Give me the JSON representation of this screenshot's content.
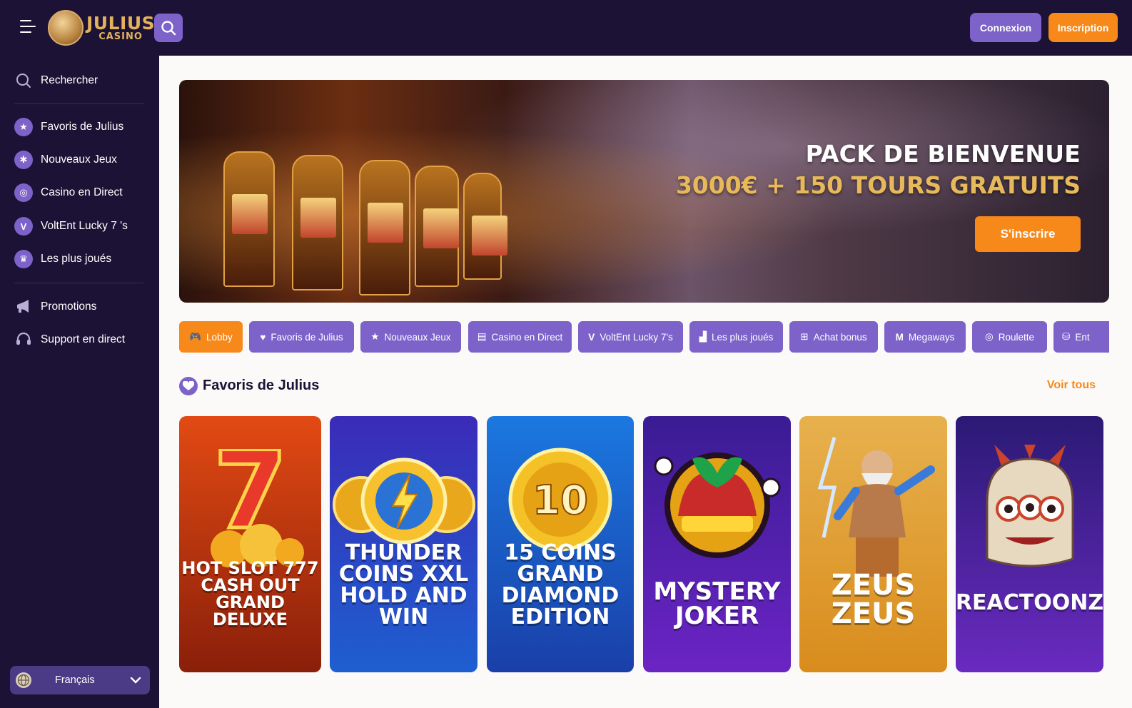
{
  "header": {
    "logo_main": "JULIUS",
    "logo_sub": "CASINO",
    "login_label": "Connexion",
    "signup_label": "Inscription"
  },
  "sidebar": {
    "search_label": "Rechercher",
    "items": [
      {
        "label": "Favoris de Julius",
        "icon": "star-icon"
      },
      {
        "label": "Nouveaux Jeux",
        "icon": "sparkle-icon"
      },
      {
        "label": "Casino en Direct",
        "icon": "roulette-icon"
      },
      {
        "label": "VoltEnt Lucky 7 's",
        "icon": "v-icon"
      },
      {
        "label": "Les plus joués",
        "icon": "trophy-icon"
      }
    ],
    "promotions_label": "Promotions",
    "support_label": "Support en direct",
    "language": "Français"
  },
  "hero": {
    "title_line1": "PACK DE BIENVENUE",
    "title_line2": "3000€ + 150 TOURS GRATUITS",
    "cta_label": "S'inscrire"
  },
  "categories": [
    {
      "label": "Lobby",
      "icon": "gamepad-icon",
      "active": true
    },
    {
      "label": "Favoris de Julius",
      "icon": "heart-icon",
      "active": false
    },
    {
      "label": "Nouveaux Jeux",
      "icon": "star-icon",
      "active": false
    },
    {
      "label": "Casino en Direct",
      "icon": "live-icon",
      "active": false
    },
    {
      "label": "VoltEnt Lucky 7's",
      "icon": "v-icon",
      "active": false
    },
    {
      "label": "Les plus joués",
      "icon": "podium-icon",
      "active": false
    },
    {
      "label": "Achat bonus",
      "icon": "gift-icon",
      "active": false
    },
    {
      "label": "Megaways",
      "icon": "megaways-icon",
      "active": false
    },
    {
      "label": "Roulette",
      "icon": "roulette-icon",
      "active": false
    },
    {
      "label": "Ent",
      "icon": "basket-icon",
      "active": false
    }
  ],
  "section": {
    "title": "Favoris de Julius",
    "see_all": "Voir tous"
  },
  "games": [
    {
      "name": "HOT SLOT 777\nCASH OUT GRAND\nDELUXE",
      "colors": [
        "#e24a13",
        "#8a1f0a"
      ]
    },
    {
      "name": "THUNDER\nCOINS XXL\nHOLD AND WIN",
      "colors": [
        "#3a2bb8",
        "#1e5fd0"
      ]
    },
    {
      "name": "15 COINS\nGRAND\nDIAMOND EDITION",
      "colors": [
        "#1b78e0",
        "#1a3fa8"
      ]
    },
    {
      "name": "MYSTERY\nJOKER",
      "colors": [
        "#3a1c94",
        "#6b24c4"
      ]
    },
    {
      "name": "ZEUS\nZEUS",
      "colors": [
        "#e7b14e",
        "#d98c1c"
      ]
    },
    {
      "name": "REACTOONZ",
      "colors": [
        "#2a1a74",
        "#6a2ac0"
      ]
    }
  ]
}
